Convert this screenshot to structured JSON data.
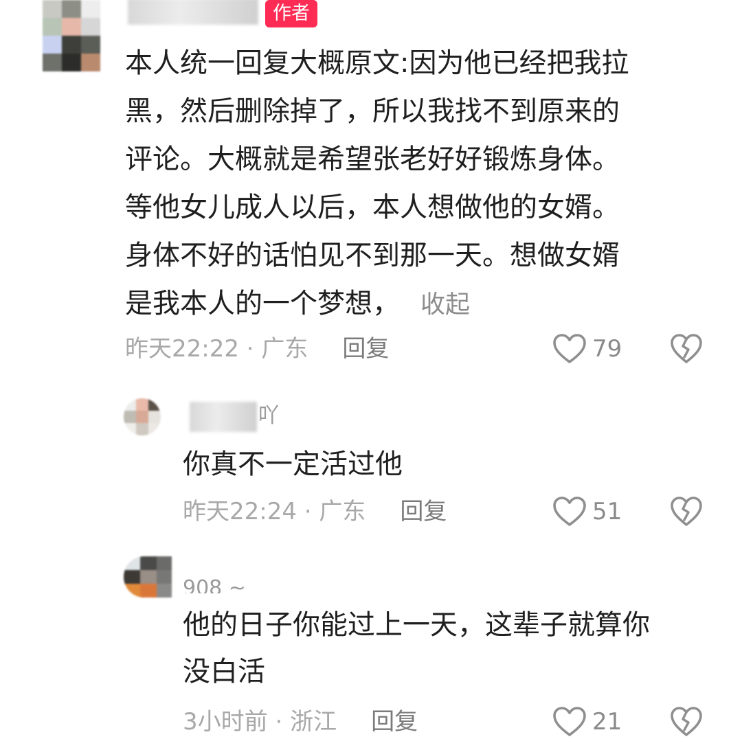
{
  "colors": {
    "author_badge_bg": "#fe2c55",
    "meta_text": "#a8a8a8",
    "icon_stroke": "#8f8f8f"
  },
  "main_comment": {
    "username_suffix": "",
    "author_badge": "作者",
    "text_lines": [
      "本人统一回复大概原文:因为他已经把我拉",
      "黑，然后删除掉了，所以我找不到原来的",
      "评论。大概就是希望张老好好锻炼身体。",
      "等他女儿成人以后，本人想做他的女婿。",
      "身体不好的话怕见不到那一天。想做女婿",
      "是我本人的一个梦想，"
    ],
    "collapse_label": "收起",
    "time": "昨天22:22",
    "separator": " · ",
    "location": "广东",
    "reply_label": "回复",
    "like_count": "79",
    "like_icon": "heart-icon",
    "dislike_icon": "broken-heart-icon"
  },
  "replies": [
    {
      "username_suffix": "吖",
      "text_lines": [
        "你真不一定活过他"
      ],
      "time": "昨天22:24",
      "separator": " · ",
      "location": "广东",
      "reply_label": "回复",
      "like_count": "51"
    },
    {
      "username_suffix": "908 ~",
      "text_lines": [
        "他的日子你能过上一天，这辈子就算你",
        "没白活"
      ],
      "time": "3小时前",
      "separator": " · ",
      "location": "浙江",
      "reply_label": "回复",
      "like_count": "21"
    }
  ]
}
